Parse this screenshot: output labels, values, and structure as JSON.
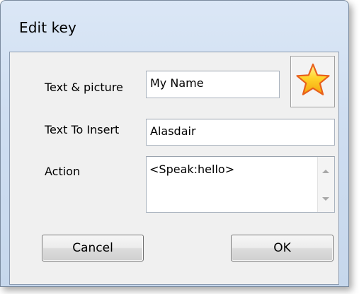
{
  "window": {
    "title": "Edit key"
  },
  "form": {
    "text_picture_label": "Text & picture",
    "text_picture_value": "My Name",
    "text_insert_label": "Text To Insert",
    "text_insert_value": "Alasdair",
    "action_label": "Action",
    "action_value": "<Speak:hello>",
    "picture_icon": "star-icon"
  },
  "buttons": {
    "cancel": "Cancel",
    "ok": "OK"
  },
  "colors": {
    "star_fill": "#ffc91c",
    "star_outline": "#e8601c"
  }
}
